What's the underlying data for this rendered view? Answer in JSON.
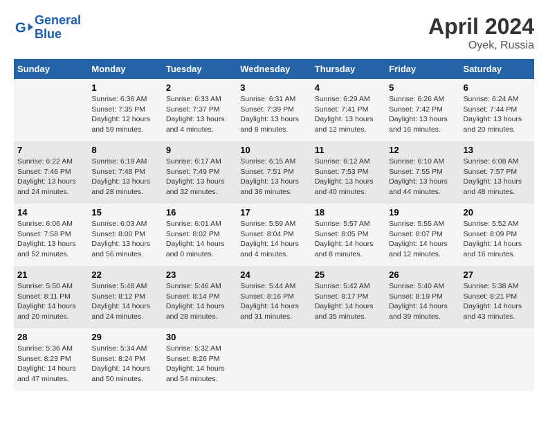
{
  "header": {
    "logo_line1": "General",
    "logo_line2": "Blue",
    "main_title": "April 2024",
    "subtitle": "Oyek, Russia"
  },
  "days_of_week": [
    "Sunday",
    "Monday",
    "Tuesday",
    "Wednesday",
    "Thursday",
    "Friday",
    "Saturday"
  ],
  "weeks": [
    [
      {
        "day": "",
        "info": ""
      },
      {
        "day": "1",
        "info": "Sunrise: 6:36 AM\nSunset: 7:35 PM\nDaylight: 12 hours\nand 59 minutes."
      },
      {
        "day": "2",
        "info": "Sunrise: 6:33 AM\nSunset: 7:37 PM\nDaylight: 13 hours\nand 4 minutes."
      },
      {
        "day": "3",
        "info": "Sunrise: 6:31 AM\nSunset: 7:39 PM\nDaylight: 13 hours\nand 8 minutes."
      },
      {
        "day": "4",
        "info": "Sunrise: 6:29 AM\nSunset: 7:41 PM\nDaylight: 13 hours\nand 12 minutes."
      },
      {
        "day": "5",
        "info": "Sunrise: 6:26 AM\nSunset: 7:42 PM\nDaylight: 13 hours\nand 16 minutes."
      },
      {
        "day": "6",
        "info": "Sunrise: 6:24 AM\nSunset: 7:44 PM\nDaylight: 13 hours\nand 20 minutes."
      }
    ],
    [
      {
        "day": "7",
        "info": "Sunrise: 6:22 AM\nSunset: 7:46 PM\nDaylight: 13 hours\nand 24 minutes."
      },
      {
        "day": "8",
        "info": "Sunrise: 6:19 AM\nSunset: 7:48 PM\nDaylight: 13 hours\nand 28 minutes."
      },
      {
        "day": "9",
        "info": "Sunrise: 6:17 AM\nSunset: 7:49 PM\nDaylight: 13 hours\nand 32 minutes."
      },
      {
        "day": "10",
        "info": "Sunrise: 6:15 AM\nSunset: 7:51 PM\nDaylight: 13 hours\nand 36 minutes."
      },
      {
        "day": "11",
        "info": "Sunrise: 6:12 AM\nSunset: 7:53 PM\nDaylight: 13 hours\nand 40 minutes."
      },
      {
        "day": "12",
        "info": "Sunrise: 6:10 AM\nSunset: 7:55 PM\nDaylight: 13 hours\nand 44 minutes."
      },
      {
        "day": "13",
        "info": "Sunrise: 6:08 AM\nSunset: 7:57 PM\nDaylight: 13 hours\nand 48 minutes."
      }
    ],
    [
      {
        "day": "14",
        "info": "Sunrise: 6:06 AM\nSunset: 7:58 PM\nDaylight: 13 hours\nand 52 minutes."
      },
      {
        "day": "15",
        "info": "Sunrise: 6:03 AM\nSunset: 8:00 PM\nDaylight: 13 hours\nand 56 minutes."
      },
      {
        "day": "16",
        "info": "Sunrise: 6:01 AM\nSunset: 8:02 PM\nDaylight: 14 hours\nand 0 minutes."
      },
      {
        "day": "17",
        "info": "Sunrise: 5:59 AM\nSunset: 8:04 PM\nDaylight: 14 hours\nand 4 minutes."
      },
      {
        "day": "18",
        "info": "Sunrise: 5:57 AM\nSunset: 8:05 PM\nDaylight: 14 hours\nand 8 minutes."
      },
      {
        "day": "19",
        "info": "Sunrise: 5:55 AM\nSunset: 8:07 PM\nDaylight: 14 hours\nand 12 minutes."
      },
      {
        "day": "20",
        "info": "Sunrise: 5:52 AM\nSunset: 8:09 PM\nDaylight: 14 hours\nand 16 minutes."
      }
    ],
    [
      {
        "day": "21",
        "info": "Sunrise: 5:50 AM\nSunset: 8:11 PM\nDaylight: 14 hours\nand 20 minutes."
      },
      {
        "day": "22",
        "info": "Sunrise: 5:48 AM\nSunset: 8:12 PM\nDaylight: 14 hours\nand 24 minutes."
      },
      {
        "day": "23",
        "info": "Sunrise: 5:46 AM\nSunset: 8:14 PM\nDaylight: 14 hours\nand 28 minutes."
      },
      {
        "day": "24",
        "info": "Sunrise: 5:44 AM\nSunset: 8:16 PM\nDaylight: 14 hours\nand 31 minutes."
      },
      {
        "day": "25",
        "info": "Sunrise: 5:42 AM\nSunset: 8:17 PM\nDaylight: 14 hours\nand 35 minutes."
      },
      {
        "day": "26",
        "info": "Sunrise: 5:40 AM\nSunset: 8:19 PM\nDaylight: 14 hours\nand 39 minutes."
      },
      {
        "day": "27",
        "info": "Sunrise: 5:38 AM\nSunset: 8:21 PM\nDaylight: 14 hours\nand 43 minutes."
      }
    ],
    [
      {
        "day": "28",
        "info": "Sunrise: 5:36 AM\nSunset: 8:23 PM\nDaylight: 14 hours\nand 47 minutes."
      },
      {
        "day": "29",
        "info": "Sunrise: 5:34 AM\nSunset: 8:24 PM\nDaylight: 14 hours\nand 50 minutes."
      },
      {
        "day": "30",
        "info": "Sunrise: 5:32 AM\nSunset: 8:26 PM\nDaylight: 14 hours\nand 54 minutes."
      },
      {
        "day": "",
        "info": ""
      },
      {
        "day": "",
        "info": ""
      },
      {
        "day": "",
        "info": ""
      },
      {
        "day": "",
        "info": ""
      }
    ]
  ]
}
